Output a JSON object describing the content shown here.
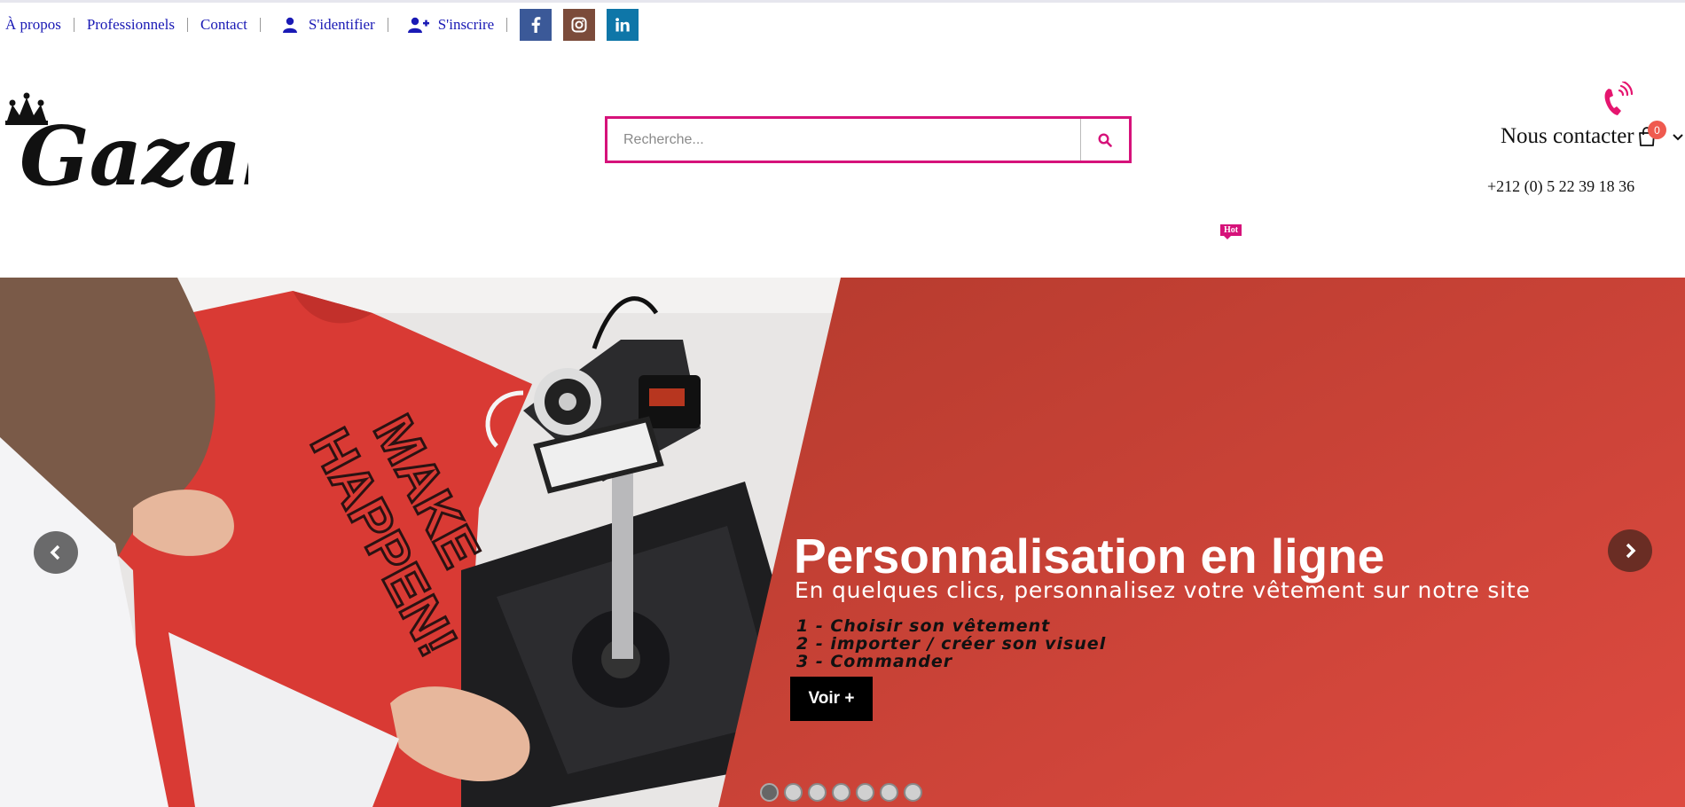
{
  "topbar": {
    "links": [
      {
        "label": "À propos"
      },
      {
        "label": "Professionnels"
      },
      {
        "label": "Contact"
      },
      {
        "label": "S'identifier",
        "icon": "user-icon"
      },
      {
        "label": "S'inscrire",
        "icon": "user-plus-icon"
      }
    ],
    "social": [
      {
        "name": "facebook-icon",
        "color": "#3b5998"
      },
      {
        "name": "instagram-icon",
        "color": "#7b4b3a"
      },
      {
        "name": "linkedin-icon",
        "color": "#0e76a8"
      }
    ]
  },
  "header": {
    "logo_text": "Gazal",
    "search_placeholder": "Recherche...",
    "contact_label": "Nous contacter",
    "phone": "+212 (0) 5 22 39 18 36",
    "cart_count": "0",
    "hot_badge": "Hot",
    "accent_color": "#d6127a"
  },
  "hero": {
    "title": "Personnalisation en ligne",
    "subtitle": "En quelques clics, personnalisez votre vêtement sur notre site",
    "steps": [
      "1 - Choisir son vêtement",
      "2 - importer / créer son visuel",
      "3 - Commander"
    ],
    "button_label": "Voir +",
    "slide_count": 7,
    "active_slide": 1
  }
}
